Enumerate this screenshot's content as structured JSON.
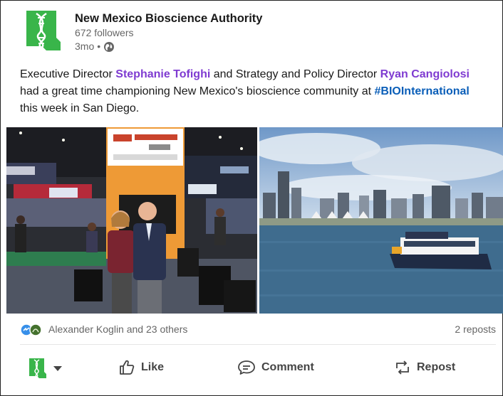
{
  "post": {
    "org_name": "New Mexico Bioscience Authority",
    "followers": "672 followers",
    "time": "3mo",
    "separator": "•",
    "text": {
      "part1": "Executive Director ",
      "mention1": "Stephanie Tofighi",
      "part2": " and Strategy and Policy Director ",
      "mention2": "Ryan Cangiolosi",
      "part3": " had a great time championing New Mexico's bioscience community at ",
      "hashtag": "#BIOInternational",
      "part4": " this week in San Diego."
    }
  },
  "images": [
    {
      "name": "conference-booth-photo"
    },
    {
      "name": "san-diego-bay-photo"
    }
  ],
  "social": {
    "reactions_text": "Alexander Koglin and 23 others",
    "reposts_text": "2 reposts"
  },
  "actions": {
    "like": "Like",
    "comment": "Comment",
    "repost": "Repost"
  },
  "colors": {
    "brand_green": "#39b54a",
    "mention_purple": "#7f3bd1",
    "hashtag_blue": "#0a5eb8"
  },
  "icons": [
    "dna-logo-icon",
    "globe-icon",
    "like-icon",
    "comment-icon",
    "repost-icon",
    "chevron-down-icon"
  ]
}
